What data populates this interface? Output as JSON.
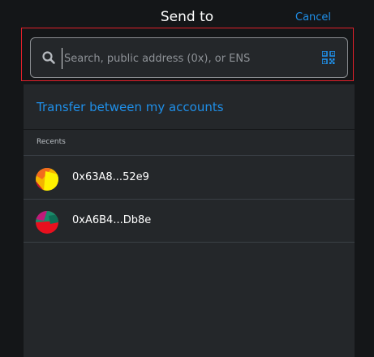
{
  "header": {
    "title": "Send to",
    "cancel_label": "Cancel"
  },
  "search": {
    "placeholder": "Search, public address (0x), or ENS",
    "value": ""
  },
  "transfer": {
    "label": "Transfer between my accounts"
  },
  "recents": {
    "heading": "Recents",
    "items": [
      {
        "address": "0x63A8...52e9"
      },
      {
        "address": "0xA6B4...Db8e"
      }
    ]
  },
  "colors": {
    "accent": "#1f8fe8",
    "highlight_border": "#e0202a",
    "panel_bg": "#24272a",
    "page_bg": "#141618"
  }
}
